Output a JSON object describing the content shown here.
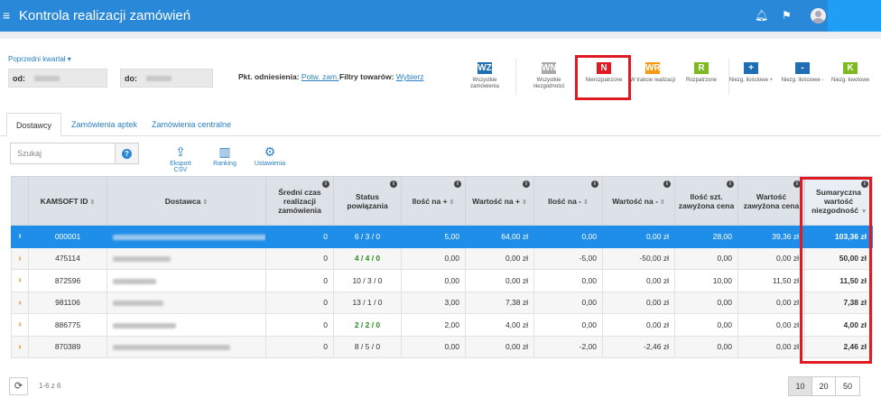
{
  "header": {
    "title": "Kontrola realizacji zamówień",
    "menu_icon": "hamburger-icon",
    "bell_icon": "bell-icon",
    "flag_icon": "flag-icon"
  },
  "filters": {
    "prev_quarter": "Poprzedni kwartał ▾",
    "od_label": "od:",
    "do_label": "do:",
    "pkt_label": "Pkt. odniesienia:",
    "pkt_value": "Potw. zam.",
    "filtry_label": "Filtry towarów:",
    "filtry_value": "Wybierz"
  },
  "status_buttons": [
    {
      "code": "WZ",
      "label": "Wszystkie zamówienia",
      "color": "#1f6fb5"
    },
    {
      "code": "WN",
      "label": "Wszystkie niezgodności",
      "color": "#aaaaaa"
    },
    {
      "code": "N",
      "label": "Nierozpatrzone",
      "color": "#e01a22"
    },
    {
      "code": "WR",
      "label": "W trakcie realizacji",
      "color": "#f39c12"
    },
    {
      "code": "R",
      "label": "Rozpatrzone",
      "color": "#7cba1f"
    },
    {
      "code": "+",
      "label": "Niezg. ilościowe +",
      "color": "#1f6fb5"
    },
    {
      "code": "-",
      "label": "Niezg. ilościowe -",
      "color": "#1f6fb5"
    },
    {
      "code": "K",
      "label": "Niezg. kwotowe",
      "color": "#7cba1f"
    }
  ],
  "tabs": [
    "Dostawcy",
    "Zamówienia aptek",
    "Zamówienia centralne"
  ],
  "search": {
    "placeholder": "Szukaj",
    "help": "?"
  },
  "tools": [
    {
      "label": "Eksport CSV",
      "icon": "upload-icon"
    },
    {
      "label": "Ranking",
      "icon": "bar-chart-icon"
    },
    {
      "label": "Ustawienia",
      "icon": "gear-icon"
    }
  ],
  "table": {
    "columns": [
      "KAMSOFT ID",
      "Dostawca",
      "Średni czas realizacji zamówienia",
      "Status powiązania",
      "Ilość na +",
      "Wartość na +",
      "Ilość na -",
      "Wartość na -",
      "Ilość szt. zawyżona cena",
      "Wartość zawyżona cena",
      "Sumaryczna wartość niezgodność"
    ],
    "rows": [
      {
        "id": "000001",
        "avg": "0",
        "status": "6 / 3 / 0",
        "qty_plus": "5,00",
        "val_plus": "64,00 zł",
        "qty_minus": "0,00",
        "val_minus": "0,00 zł",
        "qty_price": "28,00",
        "val_price": "39,36 zł",
        "sum": "103,36 zł"
      },
      {
        "id": "475114",
        "avg": "0",
        "status": "4 / 4 / 0",
        "qty_plus": "0,00",
        "val_plus": "0,00 zł",
        "qty_minus": "-5,00",
        "val_minus": "-50,00 zł",
        "qty_price": "0,00",
        "val_price": "0,00 zł",
        "sum": "50,00 zł"
      },
      {
        "id": "872596",
        "avg": "0",
        "status": "10 / 3 / 0",
        "qty_plus": "0,00",
        "val_plus": "0,00 zł",
        "qty_minus": "0,00",
        "val_minus": "0,00 zł",
        "qty_price": "10,00",
        "val_price": "11,50 zł",
        "sum": "11,50 zł"
      },
      {
        "id": "981106",
        "avg": "0",
        "status": "13 / 1 / 0",
        "qty_plus": "3,00",
        "val_plus": "7,38 zł",
        "qty_minus": "0,00",
        "val_minus": "0,00 zł",
        "qty_price": "0,00",
        "val_price": "0,00 zł",
        "sum": "7,38 zł"
      },
      {
        "id": "886775",
        "avg": "0",
        "status": "2 / 2 / 0",
        "qty_plus": "2,00",
        "val_plus": "4,00 zł",
        "qty_minus": "0,00",
        "val_minus": "0,00 zł",
        "qty_price": "0,00",
        "val_price": "0,00 zł",
        "sum": "4,00 zł"
      },
      {
        "id": "870389",
        "avg": "0",
        "status": "8 / 5 / 0",
        "qty_plus": "0,00",
        "val_plus": "0,00 zł",
        "qty_minus": "-2,00",
        "val_minus": "-2,46 zł",
        "qty_price": "0,00",
        "val_price": "0,00 zł",
        "sum": "2,46 zł"
      }
    ]
  },
  "footer": {
    "range": "1-6 z 6",
    "page_sizes": [
      "10",
      "20",
      "50"
    ]
  }
}
